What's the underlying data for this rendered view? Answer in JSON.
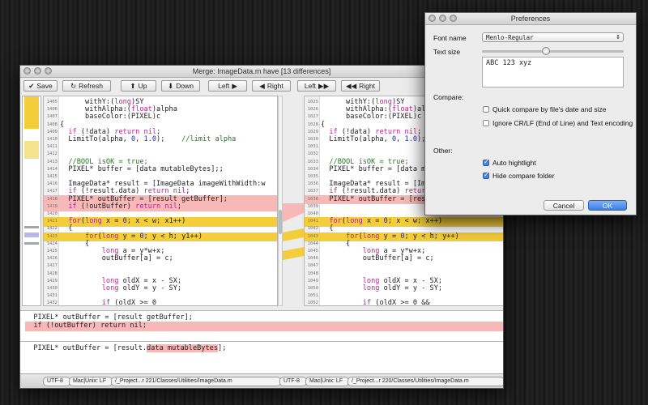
{
  "merge_window": {
    "title": "Merge: ImageData.m have  [13 differences]",
    "toolbar": {
      "save": "Save",
      "refresh": "Refresh",
      "up": "Up",
      "down": "Down",
      "left": "Left",
      "right": "Right",
      "left2": "Left",
      "right2": "Right"
    },
    "left_lines": [
      {
        "n": "1405",
        "t": "      withY:(long)SY",
        "h": ""
      },
      {
        "n": "1406",
        "t": "      withAlpha:(float)alpha",
        "h": ""
      },
      {
        "n": "1407",
        "t": "      baseColor:(PIXEL)c",
        "h": ""
      },
      {
        "n": "1408",
        "t": "{",
        "h": ""
      },
      {
        "n": "1409",
        "t": "  if (!data) return nil;",
        "h": ""
      },
      {
        "n": "1410",
        "t": "  LimitTo(alpha, 0, 1.0);    //limit alpha",
        "h": ""
      },
      {
        "n": "1411",
        "t": "",
        "h": ""
      },
      {
        "n": "1412",
        "t": "",
        "h": ""
      },
      {
        "n": "1413",
        "t": "  //BOOL isOK = true;",
        "h": ""
      },
      {
        "n": "1414",
        "t": "  PIXEL* buffer = [data mutableBytes];;",
        "h": ""
      },
      {
        "n": "1415",
        "t": "",
        "h": ""
      },
      {
        "n": "1416",
        "t": "  ImageData* result = [ImageData imageWithWidth:w",
        "h": ""
      },
      {
        "n": "1417",
        "t": "  if (!result.data) return nil;",
        "h": ""
      },
      {
        "n": "1418",
        "t": "  PIXEL* outBuffer = [result getBuffer];",
        "h": "red"
      },
      {
        "n": "1419",
        "t": "  if (!outBuffer) return nil;",
        "h": "red"
      },
      {
        "n": "1420",
        "t": "",
        "h": ""
      },
      {
        "n": "1421",
        "t": "  for(long x = 0; x < w; x1++)",
        "h": "yel"
      },
      {
        "n": "1422",
        "t": "  {",
        "h": ""
      },
      {
        "n": "1423",
        "t": "      for(long y = 0; y < h; y1++)",
        "h": "yel"
      },
      {
        "n": "1424",
        "t": "      {",
        "h": ""
      },
      {
        "n": "1425",
        "t": "          long a = y*w+x;",
        "h": ""
      },
      {
        "n": "1426",
        "t": "          outBuffer[a] = c;",
        "h": ""
      },
      {
        "n": "1427",
        "t": "",
        "h": ""
      },
      {
        "n": "1428",
        "t": "",
        "h": ""
      },
      {
        "n": "1429",
        "t": "          long oldX = x - SX;",
        "h": ""
      },
      {
        "n": "1430",
        "t": "          long oldY = y - SY;",
        "h": ""
      },
      {
        "n": "1431",
        "t": "",
        "h": ""
      },
      {
        "n": "1432",
        "t": "          if (oldX >= 0",
        "h": ""
      }
    ],
    "right_lines": [
      {
        "n": "1025",
        "t": "      withY:(long)SY",
        "h": ""
      },
      {
        "n": "1026",
        "t": "      withAlpha:(float)alpha",
        "h": ""
      },
      {
        "n": "1027",
        "t": "      baseColor:(PIXEL)c",
        "h": ""
      },
      {
        "n": "1028",
        "t": "{",
        "h": ""
      },
      {
        "n": "1029",
        "t": "  if (!data) return nil;",
        "h": ""
      },
      {
        "n": "1030",
        "t": "  LimitTo(alpha, 0, 1.0);    //l",
        "h": ""
      },
      {
        "n": "1031",
        "t": "",
        "h": ""
      },
      {
        "n": "1032",
        "t": "",
        "h": ""
      },
      {
        "n": "1033",
        "t": "  //BOOL isOK = true;",
        "h": ""
      },
      {
        "n": "1034",
        "t": "  PIXEL* buffer = [data mutableBytes];",
        "h": ""
      },
      {
        "n": "1035",
        "t": "",
        "h": ""
      },
      {
        "n": "1036",
        "t": "  ImageData* result = [ImageData",
        "h": ""
      },
      {
        "n": "1037",
        "t": "  if (!result.data) return nil;",
        "h": ""
      },
      {
        "n": "1038",
        "t": "  PIXEL* outBuffer = [result.data",
        "h": "red"
      },
      {
        "n": "1039",
        "t": "",
        "h": ""
      },
      {
        "n": "1040",
        "t": "",
        "h": ""
      },
      {
        "n": "1041",
        "t": "  for(long x = 0; x < w; x++)",
        "h": "yel"
      },
      {
        "n": "1042",
        "t": "  {",
        "h": ""
      },
      {
        "n": "1043",
        "t": "      for(long y = 0; y < h; y++)",
        "h": "yel"
      },
      {
        "n": "1044",
        "t": "      {",
        "h": ""
      },
      {
        "n": "1045",
        "t": "          long a = y*w+x;",
        "h": ""
      },
      {
        "n": "1046",
        "t": "          outBuffer[a] = c;",
        "h": ""
      },
      {
        "n": "1047",
        "t": "",
        "h": ""
      },
      {
        "n": "1048",
        "t": "",
        "h": ""
      },
      {
        "n": "1049",
        "t": "          long oldX = x - SX;",
        "h": ""
      },
      {
        "n": "1050",
        "t": "          long oldY = y - SY;",
        "h": ""
      },
      {
        "n": "1051",
        "t": "",
        "h": ""
      },
      {
        "n": "1052",
        "t": "          if (oldX >= 0 &&",
        "h": ""
      }
    ],
    "bottom_top_lines": [
      "  PIXEL* outBuffer = [result getBuffer];",
      "  if (!outBuffer) return nil;"
    ],
    "bottom_bottom_line": "  PIXEL* outBuffer = [result.data mutableBytes];",
    "status_left": {
      "encoding": "UTF-8",
      "line_endings": "Mac|Unix: LF",
      "path": "/_Project...r 221/Classes/Utilities/ImageData.m"
    },
    "status_right": {
      "encoding": "UTF-8",
      "line_endings": "Mac|Unix: LF",
      "path": "/_Project...r 220/Classes/Utilities/ImageData.m"
    }
  },
  "preferences": {
    "title": "Preferences",
    "font_name_label": "Font name",
    "font_name_value": "Menlo-Regular",
    "text_size_label": "Text size",
    "text_size_level": 0.45,
    "sample_text": "ABC 123 xyz",
    "compare_label": "Compare:",
    "quick_compare": "Quick compare by file's date and size",
    "quick_compare_checked": false,
    "ignore_crlf": "Ignore CR/LF (End of Line) and Text encoding",
    "ignore_crlf_checked": false,
    "other_label": "Other:",
    "auto_highlight": "Auto hightlight",
    "auto_highlight_checked": true,
    "hide_compare": "Hide compare folder",
    "hide_compare_checked": true,
    "cancel": "Cancel",
    "ok": "OK",
    "accent": "#3c7ee8"
  }
}
